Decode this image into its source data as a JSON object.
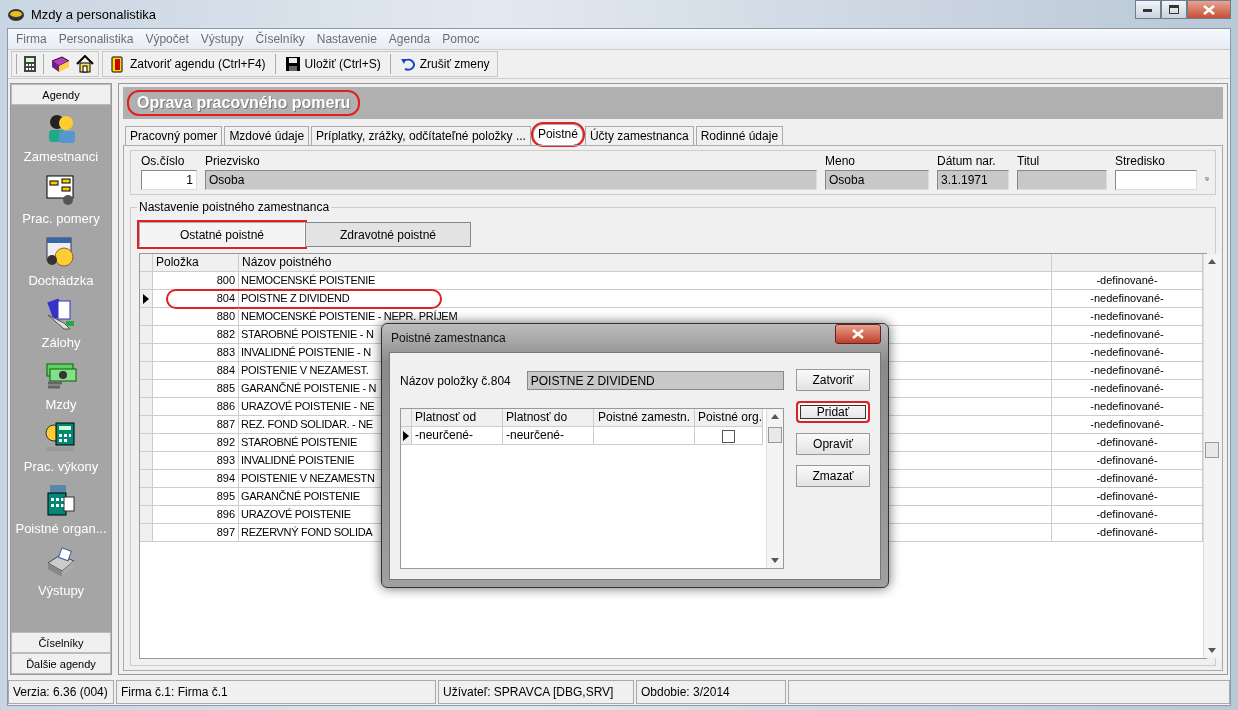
{
  "window": {
    "title": "Mzdy a personalistika"
  },
  "menu": [
    "Firma",
    "Personalistika",
    "Výpočet",
    "Výstupy",
    "Číselníky",
    "Nastavenie",
    "Agenda",
    "Pomoc"
  ],
  "toolbar": [
    "Zatvoriť agendu (Ctrl+F4)",
    "Uložiť (Ctrl+S)",
    "Zrušiť zmeny"
  ],
  "sidebar": {
    "header": "Agendy",
    "items": [
      "Zamestnanci",
      "Prac. pomery",
      "Dochádzka",
      "Zálohy",
      "Mzdy",
      "Prac. výkony",
      "Poistné organ...",
      "Výstupy"
    ],
    "footer": [
      "Číselníky",
      "Ďalšie agendy"
    ]
  },
  "header": {
    "title": "Oprava pracovného pomeru",
    "highlighted": true
  },
  "tabs": [
    {
      "label": "Pracovný pomer",
      "selected": false,
      "highlighted": false
    },
    {
      "label": "Mzdové údaje",
      "selected": false,
      "highlighted": false
    },
    {
      "label": "Príplatky, zrážky, odčítateľné položky ...",
      "selected": false,
      "highlighted": false
    },
    {
      "label": "Poistné",
      "selected": true,
      "highlighted": true
    },
    {
      "label": "Účty zamestnanca",
      "selected": false,
      "highlighted": false
    },
    {
      "label": "Rodinné údaje",
      "selected": false,
      "highlighted": false
    }
  ],
  "fields": [
    {
      "label": "Os.číslo",
      "value": "1",
      "editable": true
    },
    {
      "label": "Priezvisko",
      "value": "Osoba",
      "editable": false
    },
    {
      "label": "Meno",
      "value": "Osoba",
      "editable": false
    },
    {
      "label": "Dátum nar.",
      "value": "3.1.1971",
      "editable": false
    },
    {
      "label": "Titul",
      "editable": false
    },
    {
      "label": "Stredisko",
      "editable": true
    }
  ],
  "group": {
    "title": "Nastavenie poistného zamestnanca",
    "subtabs": [
      {
        "label": "Ostatné poistné",
        "selected": true,
        "highlighted": true
      },
      {
        "label": "Zdravotné poistné",
        "selected": false,
        "highlighted": false
      }
    ],
    "table": {
      "columns": [
        "Položka",
        "Názov poistného"
      ],
      "rows": [
        {
          "polozka": "800",
          "nazov": "NEMOCENSKÉ POISTENIE",
          "column_3": "-definované-",
          "current": false,
          "highlighted": false
        },
        {
          "polozka": "804",
          "nazov": "POISTNE Z DIVIDEND",
          "column_3": "-nedefinované-",
          "current": true,
          "highlighted": true
        },
        {
          "polozka": "880",
          "nazov": "NEMOCENSKÉ POISTENIE - NEPR. PRÍJEM",
          "column_3": "-nedefinované-",
          "current": false,
          "highlighted": false
        },
        {
          "polozka": "882",
          "nazov": "STAROBNÉ POISTENIE - N",
          "column_3": "-nedefinované-",
          "current": false,
          "highlighted": false
        },
        {
          "polozka": "883",
          "nazov": "INVALIDNÉ POISTENIE - N",
          "column_3": "-nedefinované-",
          "current": false,
          "highlighted": false
        },
        {
          "polozka": "884",
          "nazov": "POISTENIE V NEZAMEST.",
          "column_3": "-nedefinované-",
          "current": false,
          "highlighted": false
        },
        {
          "polozka": "885",
          "nazov": "GARANČNÉ POISTENIE - N",
          "column_3": "-nedefinované-",
          "current": false,
          "highlighted": false
        },
        {
          "polozka": "886",
          "nazov": "URAZOVÉ POISTENIE - NE",
          "column_3": "-nedefinované-",
          "current": false,
          "highlighted": false
        },
        {
          "polozka": "887",
          "nazov": "REZ. FOND SOLIDAR. - NE",
          "column_3": "-nedefinované-",
          "current": false,
          "highlighted": false
        },
        {
          "polozka": "892",
          "nazov": "STAROBNÉ POISTENIE",
          "column_3": "-definované-",
          "current": false,
          "highlighted": false
        },
        {
          "polozka": "893",
          "nazov": "INVALIDNÉ POISTENIE",
          "column_3": "-definované-",
          "current": false,
          "highlighted": false
        },
        {
          "polozka": "894",
          "nazov": "POISTENIE V NEZAMESTN",
          "column_3": "-definované-",
          "current": false,
          "highlighted": false
        },
        {
          "polozka": "895",
          "nazov": "GARANČNÉ POISTENIE",
          "column_3": "-definované-",
          "current": false,
          "highlighted": false
        },
        {
          "polozka": "896",
          "nazov": "URAZOVÉ POISTENIE",
          "column_3": "-definované-",
          "current": false,
          "highlighted": false
        },
        {
          "polozka": "897",
          "nazov": "REZERVNÝ FOND SOLIDA",
          "column_3": "-definované-",
          "current": false,
          "highlighted": false
        }
      ]
    }
  },
  "dialog": {
    "title": "Poistné zamestnanca",
    "name_label": "Názov položky č.804",
    "name_value": "POISTNE Z DIVIDEND",
    "columns": [
      "Platnosť od",
      "Platnosť do",
      "Poistné  zamestn.",
      "Poistné org."
    ],
    "rows": [
      {
        "platnost_od": "-neurčené-",
        "platnost_do": "-neurčené-",
        "poistne_org": false,
        "current": true
      }
    ],
    "buttons": [
      {
        "label": "Zatvoriť",
        "highlighted": false
      },
      {
        "label": "Pridať",
        "highlighted": true
      },
      {
        "label": "Opraviť",
        "highlighted": false
      },
      {
        "label": "Zmazať",
        "highlighted": false
      }
    ]
  },
  "status_bar": [
    "Verzia: 6.36 (004)",
    "Firma č.1: Firma č.1",
    "Užívateľ: SPRAVCA [DBG,SRV]",
    "Obdobie: 3/2014"
  ]
}
